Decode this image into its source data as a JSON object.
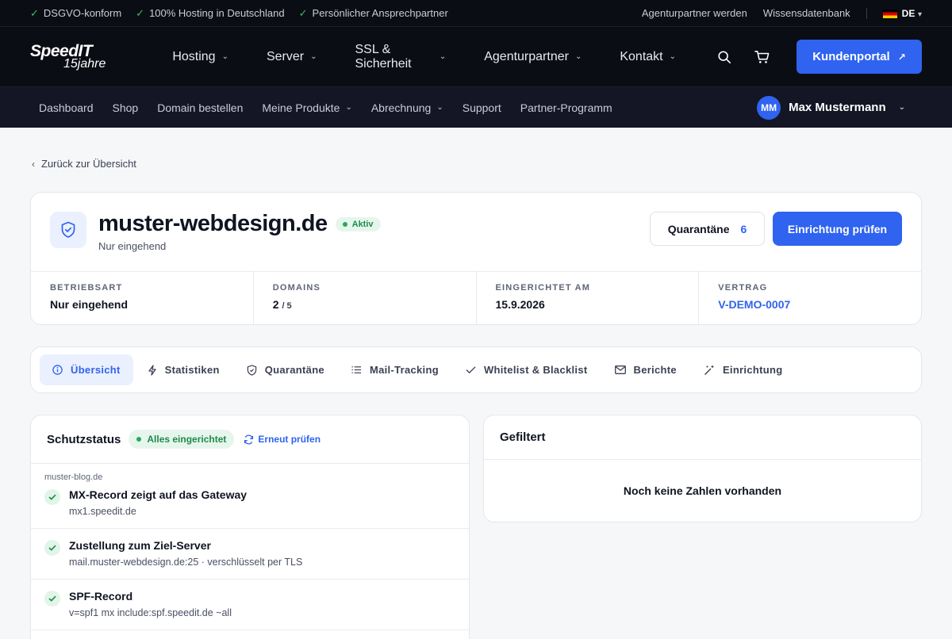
{
  "topbar": {
    "usps": [
      "DSGVO-konform",
      "100% Hosting in Deutschland",
      "Persönlicher Ansprechpartner"
    ],
    "links": [
      "Agenturpartner werden",
      "Wissensdatenbank"
    ],
    "lang": "DE"
  },
  "brand": {
    "name": "SpeedIT",
    "tagline": "15jahre"
  },
  "mainnav": {
    "items": [
      "Hosting",
      "Server",
      "SSL & Sicherheit",
      "Agenturpartner",
      "Kontakt"
    ],
    "portal_button": "Kundenportal"
  },
  "subnav": {
    "items": [
      "Dashboard",
      "Shop",
      "Domain bestellen",
      "Meine Produkte",
      "Abrechnung",
      "Support",
      "Partner-Programm"
    ],
    "user_initials": "MM",
    "user_name": "Max Mustermann"
  },
  "back_link": "Zurück zur Übersicht",
  "product": {
    "title": "muster-webdesign.de",
    "status": "Aktiv",
    "subtitle": "Nur eingehend",
    "quarantine_label": "Quarantäne",
    "quarantine_count": "6",
    "setup_button": "Einrichtung prüfen",
    "stats": [
      {
        "label": "BETRIEBSART",
        "value": "Nur eingehend"
      },
      {
        "label": "DOMAINS",
        "value": "2",
        "extra": "/ 5"
      },
      {
        "label": "EINGERICHTET AM",
        "value": "15.9.2026"
      },
      {
        "label": "VERTRAG",
        "value": "V-DEMO-0007"
      }
    ]
  },
  "tabs": [
    "Übersicht",
    "Statistiken",
    "Quarantäne",
    "Mail-Tracking",
    "Whitelist & Blacklist",
    "Berichte",
    "Einrichtung"
  ],
  "protection": {
    "title": "Schutzstatus",
    "badge": "Alles eingerichtet",
    "recheck": "Erneut prüfen",
    "domain": "muster-blog.de",
    "checks": [
      {
        "title": "MX-Record zeigt auf das Gateway",
        "detail": "mx1.speedit.de"
      },
      {
        "title": "Zustellung zum Ziel-Server",
        "detail": "mail.muster-webdesign.de:25 · verschlüsselt per TLS"
      },
      {
        "title": "SPF-Record",
        "detail": "v=spf1 mx include:spf.speedit.de ~all"
      }
    ]
  },
  "filtered": {
    "title": "Gefiltert",
    "empty": "Noch keine Zahlen vorhanden"
  },
  "colors": {
    "accent": "#2f63f0",
    "success": "#1f8a4c",
    "dark": "#0b0d14"
  }
}
